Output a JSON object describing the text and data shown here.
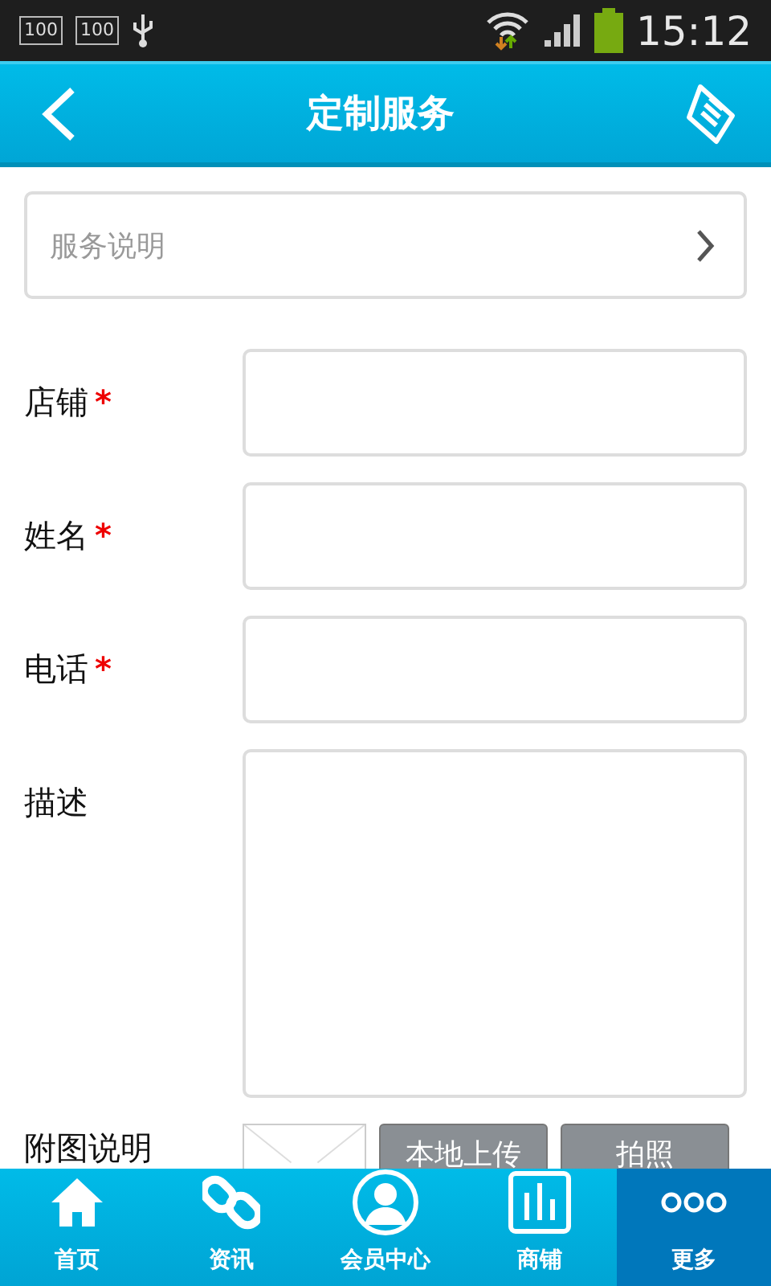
{
  "status_bar": {
    "time": "15:12",
    "badges": [
      "100",
      "100"
    ]
  },
  "header": {
    "title": "定制服务"
  },
  "service_row": {
    "label": "服务说明"
  },
  "form": {
    "fields": [
      {
        "kind": "input",
        "label": "店铺",
        "required": true
      },
      {
        "kind": "input",
        "label": "姓名",
        "required": true
      },
      {
        "kind": "input",
        "label": "电话",
        "required": true
      },
      {
        "kind": "textarea",
        "label": "描述",
        "required": false
      }
    ],
    "required_mark": "*"
  },
  "attachment": {
    "label": "附图说明",
    "buttons": [
      "本地上传",
      "拍照"
    ]
  },
  "nav": [
    {
      "kind": "home",
      "label": "首页",
      "selected": false
    },
    {
      "kind": "link",
      "label": "资讯",
      "selected": false
    },
    {
      "kind": "person",
      "label": "会员中心",
      "selected": false
    },
    {
      "kind": "chart",
      "label": "商铺",
      "selected": false
    },
    {
      "kind": "dots",
      "label": "更多",
      "selected": true
    }
  ]
}
